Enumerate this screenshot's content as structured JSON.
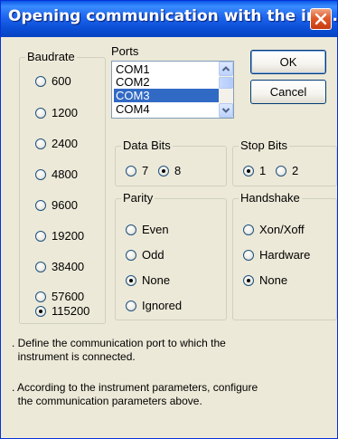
{
  "window": {
    "title": "Opening communication with the ins..."
  },
  "baudrate": {
    "label": "Baudrate",
    "options": [
      "600",
      "1200",
      "2400",
      "4800",
      "9600",
      "19200",
      "38400",
      "57600",
      "115200"
    ],
    "selected": "115200"
  },
  "ports": {
    "label": "Ports",
    "items": [
      "COM1",
      "COM2",
      "COM3",
      "COM4"
    ],
    "selected": "COM3"
  },
  "buttons": {
    "ok": "OK",
    "cancel": "Cancel"
  },
  "data_bits": {
    "label": "Data Bits",
    "options": [
      "7",
      "8"
    ],
    "selected": "8"
  },
  "stop_bits": {
    "label": "Stop Bits",
    "options": [
      "1",
      "2"
    ],
    "selected": "1"
  },
  "parity": {
    "label": "Parity",
    "options": [
      "Even",
      "Odd",
      "None",
      "Ignored"
    ],
    "selected": "None"
  },
  "handshake": {
    "label": "Handshake",
    "options": [
      "Xon/Xoff",
      "Hardware",
      "None"
    ],
    "selected": "None"
  },
  "info": {
    "line1": ". Define the communication port to which the\n  instrument is connected.",
    "line2": ". According to the instrument parameters, configure\n  the communication parameters above."
  },
  "icons": {
    "close": "close-icon",
    "scroll_up": "chevron-up-icon",
    "scroll_down": "chevron-down-icon"
  }
}
